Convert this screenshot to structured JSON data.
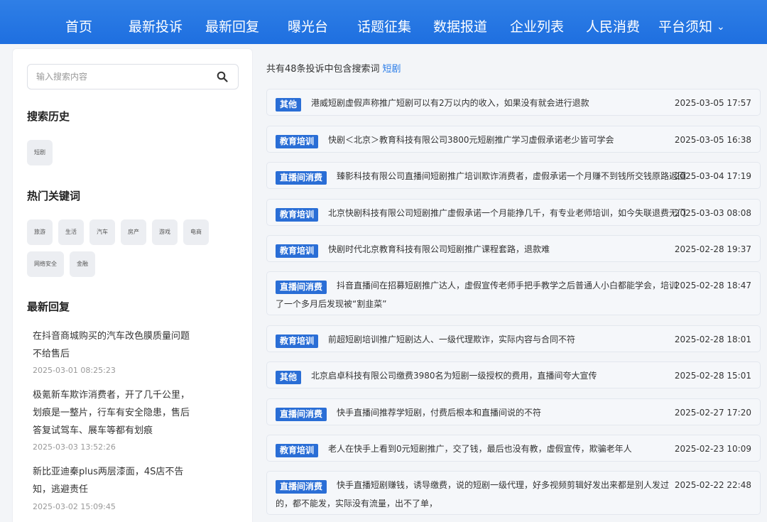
{
  "nav": {
    "items": [
      "首页",
      "最新投诉",
      "最新回复",
      "曝光台",
      "话题征集",
      "数据报道",
      "企业列表",
      "人民消费",
      "平台须知"
    ],
    "dropdown_chevron": "⌄"
  },
  "sidebar": {
    "search": {
      "placeholder": "输入搜索内容",
      "value": ""
    },
    "history_title": "搜索历史",
    "history": [
      "短剧"
    ],
    "hot_title": "热门关键词",
    "hot_keywords": [
      "旅游",
      "生活",
      "汽车",
      "房产",
      "游戏",
      "电商",
      "网络安全",
      "金融"
    ],
    "replies_title": "最新回复",
    "replies": [
      {
        "text": "在抖音商城购买的汽车改色膜质量问题不给售后",
        "time": "2025-03-01 08:25:23"
      },
      {
        "text": "极氪新车欺诈消费者，开了几千公里，划痕是一整片，行车有安全隐患，售后答复试驾车、展车等都有划痕",
        "time": "2025-03-03 13:52:26"
      },
      {
        "text": "新比亚迪秦plus两层漆面，4S店不告知，逃避责任",
        "time": "2025-03-02 15:09:45"
      }
    ]
  },
  "results": {
    "summary_prefix": "共有48条投诉中包含搜索词",
    "keyword": "短剧",
    "items": [
      {
        "tag": "其他",
        "title": "港威短剧虚假声称推广短剧可以有2万以内的收入，如果没有就会进行退款",
        "time": "2025-03-05 17:57"
      },
      {
        "tag": "教育培训",
        "title": "快剧＜北京＞教育科技有限公司3800元短剧推广学习虚假承诺老少皆可学会",
        "time": "2025-03-05 16:38"
      },
      {
        "tag": "直播间消费",
        "title": "臻影科技有限公司直播间短剧推广培训欺诈消费者，虚假承诺一个月赚不到钱所交钱原路返回",
        "time": "2025-03-04 17:19"
      },
      {
        "tag": "教育培训",
        "title": "北京快剧科技有限公司短剧推广虚假承诺一个月能挣几千，有专业老师培训，如今失联退费无门",
        "time": "2025-03-03 08:08"
      },
      {
        "tag": "教育培训",
        "title": "快剧时代北京教育科技有限公司短剧推广课程套路，退款难",
        "time": "2025-02-28 19:37"
      },
      {
        "tag": "直播间消费",
        "title": "抖音直播间在招募短剧推广达人，虚假宣传老师手把手教学之后普通人小白都能学会，培训了一个多月后发现被“割韭菜”",
        "time": "2025-02-28 18:47"
      },
      {
        "tag": "教育培训",
        "title": "前超短剧培训推广短剧达人、一级代理欺诈，实际内容与合同不符",
        "time": "2025-02-28 18:01"
      },
      {
        "tag": "其他",
        "title": "北京启卓科技有限公司缴费3980名为短剧一级授权的费用，直播间夸大宣传",
        "time": "2025-02-28 15:01"
      },
      {
        "tag": "直播间消费",
        "title": "快手直播间推荐学短剧，付费后根本和直播间说的不符",
        "time": "2025-02-27 17:20"
      },
      {
        "tag": "教育培训",
        "title": "老人在快手上看到0元短剧推广，交了钱，最后也没有教，虚假宣传，欺骗老年人",
        "time": "2025-02-23 10:09"
      },
      {
        "tag": "直播间消费",
        "title": "快手直播短剧赚钱，诱导缴费，说的短剧一级代理，好多视频剪辑好发出来都是别人发过的，都不能发，实际没有流量，出不了单，",
        "time": "2025-02-22 22:48"
      }
    ]
  },
  "colors": {
    "nav_bg": "#1e6fe0",
    "badge_bg": "#2a6ed6",
    "keyword": "#2b7de9"
  }
}
